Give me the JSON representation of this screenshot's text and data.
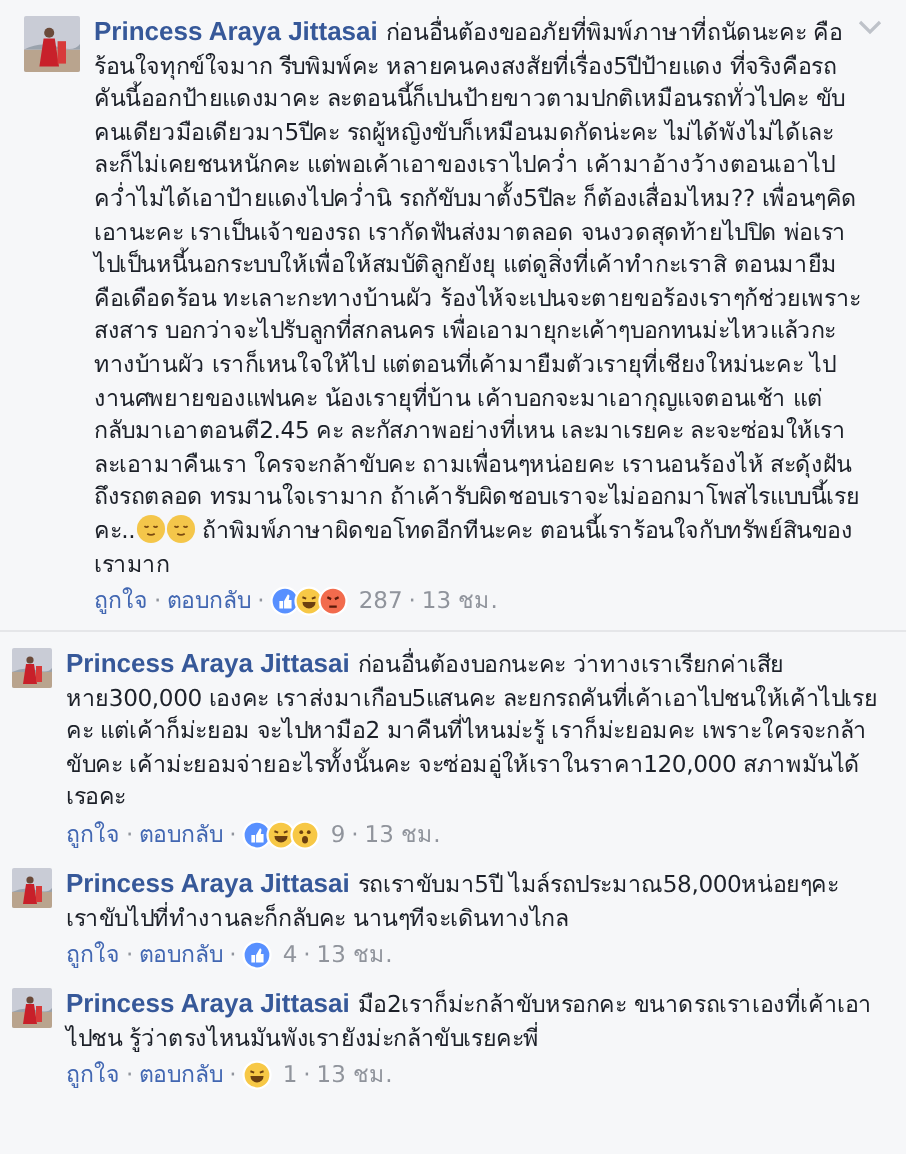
{
  "comments": [
    {
      "kind": "top",
      "author": "Princess Araya Jittasai",
      "body": [
        {
          "kind": "text",
          "text": "ก่อนอื่นต้องขออภัยที่พิมพ์ภาษาที่ถนัดนะคะ คือร้อนใจทุกข์ใจมาก รีบพิมพ์คะ หลายคนคงสงสัยที่เรื่อง5ปีป้ายแดง ที่จริงคือรถคันนี้ออกป้ายแดงมาคะ ละตอนนี้ก็เปนป้ายขาวตามปกติเหมือนรถทั่วไปคะ ขับคนเดียวมือเดียวมา5ปีคะ รถผู้หญิงขับก็เหมือนมดกัดน่ะคะ ไม่ได้พังไม่ได้เละ ละก็ไม่เคยชนหนักคะ แต่พอเค้าเอาของเราไปคว่ำ เค้ามาอ้างว้างตอนเอาไปคว่ำไม่ได้เอาป้ายแดงไปคว่ำนิ รถกัขับมาตั้ง5ปีละ ก็ต้องเสื่อมไหม?? เพื่อนๆคิดเอานะคะ เราเป็นเจ้าของรถ เรากัดฟันส่งมาตลอด จนงวดสุดท้ายไปปิด พ่อเราไปเป็นหนี้นอกระบบให้เพื่อให้สมบัติลูกยังยุ แต่ดูสิ่งที่เค้าทำกะเราสิ ตอนมายืมคือเดือดร้อน ทะเลาะกะทางบ้านผัว ร้องไห้จะเปนจะตายขอร้องเราๆก้ช่วยเพราะสงสาร บอกว่าจะไปรับลูกที่สกลนคร เพื่อเอามายุกะเค้าๆบอกทนม่ะไหวแล้วกะทางบ้านผัว เราก็เหนใจให้ไป แต่ตอนที่เค้ามายืมตัวเรายุที่เชียงใหม่นะคะ ไปงานศพยายของแฟนคะ น้องเรายุที่บ้าน เค้าบอกจะมาเอากุญแจตอนเช้า แต่กลับมาเอาตอนตี2.45 คะ ละกัสภาพอย่างที่เหน เละมาเรยคะ ละจะซ่อมให้เราละเอามาคืนเรา ใครจะกล้าขับคะ ถามเพื่อนๆหน่อยคะ เรานอนร้องไห้ สะดุ้งฝันถึงรถตลอด ทรมานใจเรามาก ถ้าเค้ารับผิดชอบเราจะไม่ออกมาโพสไรแบบนี้เรยคะ.."
        },
        {
          "kind": "emoji"
        },
        {
          "kind": "emoji"
        },
        {
          "kind": "text",
          "text": " ถ้าพิมพ์ภาษาผิดขอโทดอีกทีนะคะ ตอนนี้เราร้อนใจกับทรัพย์สินของเรามาก"
        }
      ],
      "like": "ถูกใจ",
      "reply": "ตอบกลับ",
      "separators": [
        "·",
        "·",
        "·"
      ],
      "reactions": [
        {
          "kind": "like"
        },
        {
          "kind": "haha"
        },
        {
          "kind": "angry"
        }
      ],
      "count": "287",
      "time": "13 ชม."
    },
    {
      "kind": "reply",
      "author": "Princess Araya Jittasai",
      "body": [
        {
          "kind": "text",
          "text": "ก่อนอื่นต้องบอกนะคะ ว่าทางเราเรียกค่าเสียหาย300,000 เองคะ เราส่งมาเกือบ5แสนคะ ละยกรถคันที่เค้าเอาไปชนให้เค้าไปเรยคะ แต่เค้าก็ม่ะยอม จะไปหามือ2 มาคืนที่ไหนม่ะรู้ เราก็ม่ะยอมคะ เพราะใครจะกล้าขับคะ เค้าม่ะยอมจ่ายอะไรทั้งนั้นคะ จะซ่อมอู่ให้เราในราคา120,000 สภาพมันได้เรอคะ"
        }
      ],
      "like": "ถูกใจ",
      "reply": "ตอบกลับ",
      "separators": [
        "·",
        "·",
        "·"
      ],
      "reactions": [
        {
          "kind": "like"
        },
        {
          "kind": "haha"
        },
        {
          "kind": "wow"
        }
      ],
      "count": "9",
      "time": "13 ชม."
    },
    {
      "kind": "reply",
      "author": "Princess Araya Jittasai",
      "body": [
        {
          "kind": "text",
          "text": "รถเราขับมา5ปี ไมล์รถประมาณ58,000หน่อยๆคะ เราขับไปที่ทำงานละก็กลับคะ นานๆทีจะเดินทางไกล"
        }
      ],
      "like": "ถูกใจ",
      "reply": "ตอบกลับ",
      "separators": [
        "·",
        "·",
        "·"
      ],
      "reactions": [
        {
          "kind": "like"
        }
      ],
      "count": "4",
      "time": "13 ชม."
    },
    {
      "kind": "reply",
      "author": "Princess Araya Jittasai",
      "body": [
        {
          "kind": "text",
          "text": "มือ2เราก็ม่ะกล้าขับหรอกคะ ขนาดรถเราเองที่เค้าเอาไปชน รู้ว่าตรงไหนมันพังเรายังม่ะกล้าขับเรยคะพี่"
        }
      ],
      "like": "ถูกใจ",
      "reply": "ตอบกลับ",
      "separators": [
        "·",
        "·",
        "·"
      ],
      "reactions": [
        {
          "kind": "haha"
        }
      ],
      "count": "1",
      "time": "13 ชม."
    }
  ]
}
